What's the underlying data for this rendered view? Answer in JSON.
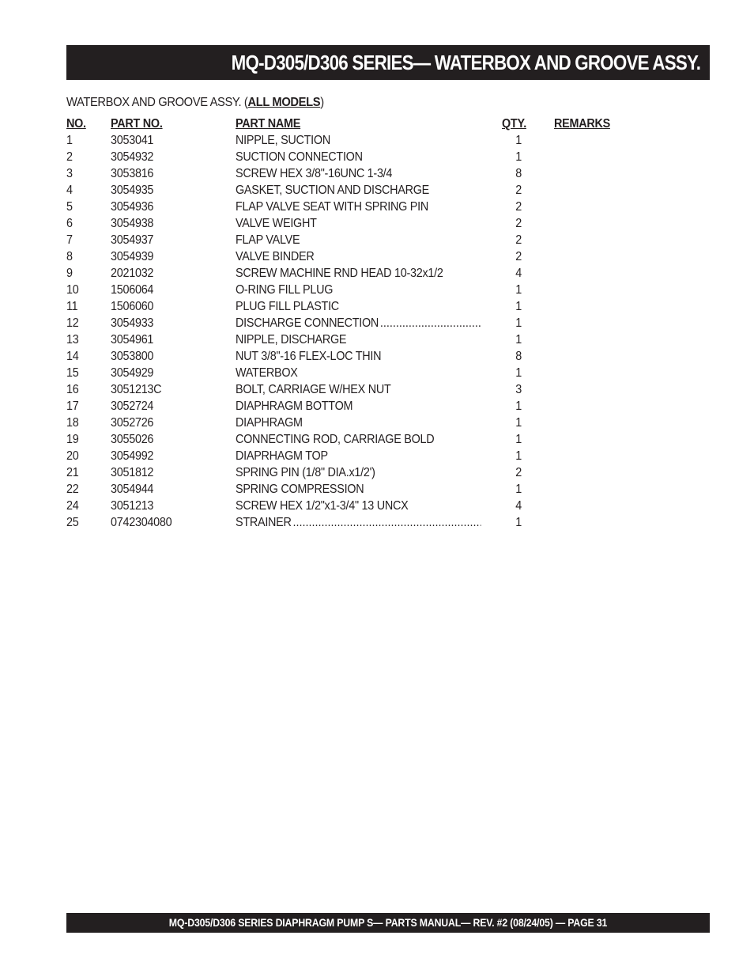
{
  "header": {
    "title": "MQ-D305/D306 SERIES— WATERBOX AND GROOVE ASSY."
  },
  "section": {
    "title_prefix": "WATERBOX AND GROOVE ASSY. (",
    "title_models": "ALL MODELS",
    "title_suffix": ")"
  },
  "table": {
    "columns": {
      "no": "NO.",
      "part_no": "PART NO.",
      "part_name": "PART NAME",
      "qty": "QTY.",
      "remarks": "REMARKS"
    },
    "rows": [
      {
        "no": "1",
        "part_no": "3053041",
        "part_name": "NIPPLE, SUCTION",
        "qty": "1",
        "remarks": "",
        "leader": false
      },
      {
        "no": "2",
        "part_no": "3054932",
        "part_name": "SUCTION CONNECTION",
        "qty": "1",
        "remarks": "",
        "leader": false
      },
      {
        "no": "3",
        "part_no": "3053816",
        "part_name": "SCREW HEX 3/8\"-16UNC 1-3/4",
        "qty": "8",
        "remarks": "",
        "leader": false
      },
      {
        "no": "4",
        "part_no": "3054935",
        "part_name": "GASKET, SUCTION AND DISCHARGE",
        "qty": "2",
        "remarks": "",
        "leader": false
      },
      {
        "no": "5",
        "part_no": "3054936",
        "part_name": "FLAP VALVE SEAT WITH SPRING PIN",
        "qty": "2",
        "remarks": "",
        "leader": false
      },
      {
        "no": "6",
        "part_no": "3054938",
        "part_name": "VALVE WEIGHT",
        "qty": "2",
        "remarks": "",
        "leader": false
      },
      {
        "no": "7",
        "part_no": "3054937",
        "part_name": "FLAP  VALVE",
        "qty": "2",
        "remarks": "",
        "leader": false
      },
      {
        "no": "8",
        "part_no": "3054939",
        "part_name": "VALVE  BINDER",
        "qty": "2",
        "remarks": "",
        "leader": false
      },
      {
        "no": "9",
        "part_no": "2021032",
        "part_name": "SCREW MACHINE RND HEAD 10-32x1/2",
        "qty": "4",
        "remarks": "",
        "leader": false
      },
      {
        "no": "10",
        "part_no": "1506064",
        "part_name": "O-RING FILL PLUG",
        "qty": "1",
        "remarks": "",
        "leader": false
      },
      {
        "no": "11",
        "part_no": "1506060",
        "part_name": "PLUG FILL PLASTIC",
        "qty": "1",
        "remarks": "",
        "leader": false
      },
      {
        "no": "12",
        "part_no": "3054933",
        "part_name": "DISCHARGE CONNECTION",
        "qty": "1",
        "remarks": "",
        "leader": true
      },
      {
        "no": "13",
        "part_no": "3054961",
        "part_name": "NIPPLE, DISCHARGE",
        "qty": "1",
        "remarks": "",
        "leader": false
      },
      {
        "no": "14",
        "part_no": "3053800",
        "part_name": "NUT 3/8\"-16 FLEX-LOC THIN",
        "qty": "8",
        "remarks": "",
        "leader": false
      },
      {
        "no": "15",
        "part_no": "3054929",
        "part_name": "WATERBOX",
        "qty": "1",
        "remarks": "",
        "leader": false
      },
      {
        "no": "16",
        "part_no": "3051213C",
        "part_name": "BOLT, CARRIAGE W/HEX NUT",
        "qty": "3",
        "remarks": "",
        "leader": false
      },
      {
        "no": "17",
        "part_no": "3052724",
        "part_name": "DIAPHRAGM BOTTOM",
        "qty": "1",
        "remarks": "",
        "leader": false
      },
      {
        "no": "18",
        "part_no": "3052726",
        "part_name": "DIAPHRAGM",
        "qty": "1",
        "remarks": "",
        "leader": false
      },
      {
        "no": "19",
        "part_no": "3055026",
        "part_name": "CONNECTING ROD, CARRIAGE BOLD",
        "qty": "1",
        "remarks": "",
        "leader": false
      },
      {
        "no": "20",
        "part_no": "3054992",
        "part_name": "DIAPRHAGM TOP",
        "qty": "1",
        "remarks": "",
        "leader": false
      },
      {
        "no": "21",
        "part_no": "3051812",
        "part_name": "SPRING PIN (1/8\" DIA.x1/2')",
        "qty": "2",
        "remarks": "",
        "leader": false
      },
      {
        "no": "22",
        "part_no": "3054944",
        "part_name": "SPRING COMPRESSION",
        "qty": "1",
        "remarks": "",
        "leader": false
      },
      {
        "no": "24",
        "part_no": "3051213",
        "part_name": "SCREW HEX 1/2\"x1-3/4\" 13 UNCX",
        "qty": "4",
        "remarks": "",
        "leader": false
      },
      {
        "no": "25",
        "part_no": "0742304080",
        "part_name": "STRAINER",
        "qty": "1",
        "remarks": "",
        "leader": true
      }
    ],
    "leader_dots": "............................................................................................................"
  },
  "footer": {
    "text": "MQ-D305/D306 SERIES DIAPHRAGM PUMP S— PARTS  MANUAL— REV. #2  (08/24/05) — PAGE 31"
  },
  "colors": {
    "bar_background": "#231f20",
    "bar_text": "#ffffff",
    "body_text": "#231f20"
  }
}
